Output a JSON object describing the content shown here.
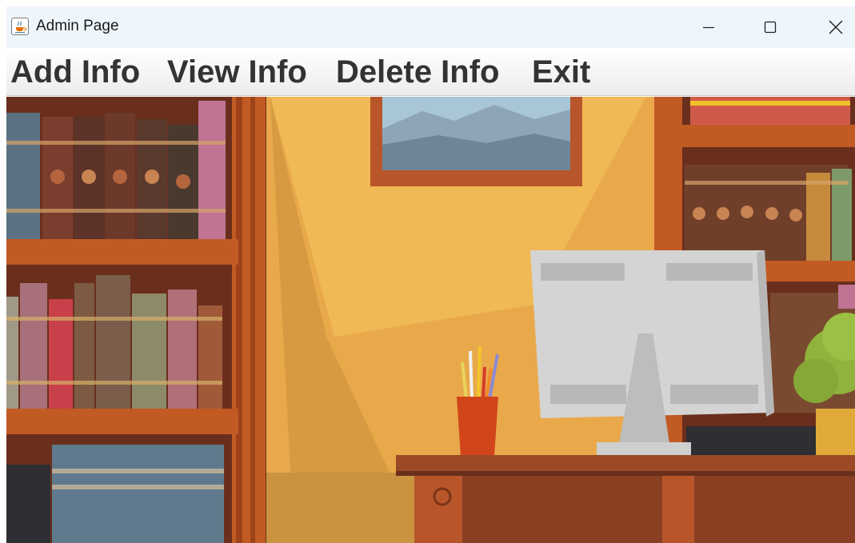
{
  "window": {
    "title": "Admin Page",
    "icon": "java-coffee-icon"
  },
  "controls": {
    "minimize": "minimize-icon",
    "maximize": "maximize-icon",
    "close": "close-icon"
  },
  "menu": {
    "items": [
      {
        "label": "Add Info"
      },
      {
        "label": "View Info"
      },
      {
        "label": "Delete Info"
      },
      {
        "label": "Exit"
      }
    ]
  },
  "colors": {
    "titlebar_bg": "#eef5fb",
    "menu_text": "#333333",
    "wall": "#e9a94b",
    "shelf_wood": "#b5551f",
    "desk": "#9b4a25"
  }
}
